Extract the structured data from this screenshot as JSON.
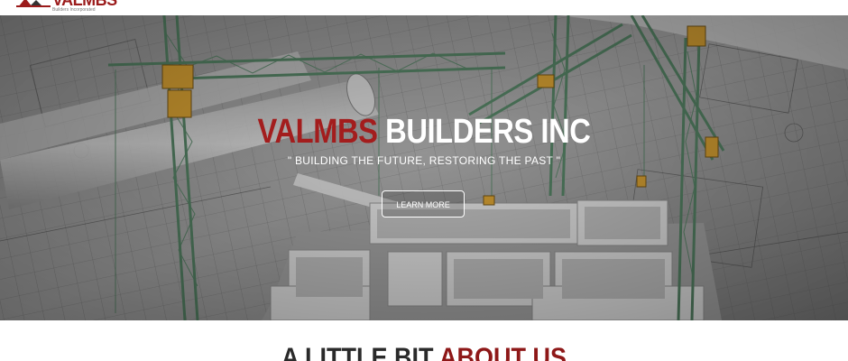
{
  "brand": {
    "logo_text": "VALMBS",
    "logo_sub": "Builders Incorporated"
  },
  "hero": {
    "title_accent": "VALMBS",
    "title_rest": " BUILDERS INC",
    "tagline": "\" BUILDING THE FUTURE, RESTORING THE PAST \"",
    "cta_label": "LEARN MORE"
  },
  "about": {
    "heading_plain": "A LITTLE BIT ",
    "heading_accent": "ABOUT US"
  },
  "colors": {
    "accent": "#a31d1d",
    "crane_green": "#4f7a5e",
    "crane_yellow": "#c9962f"
  }
}
